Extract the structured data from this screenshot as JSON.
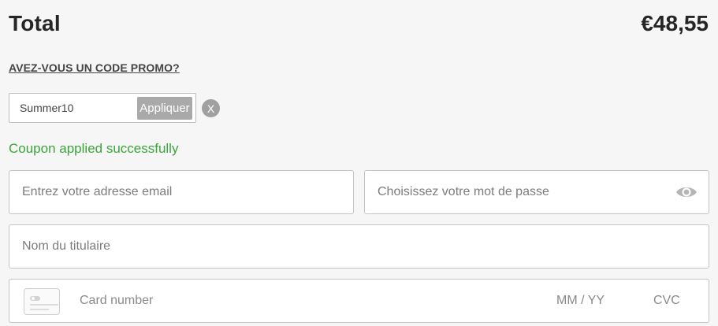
{
  "summary": {
    "total_label": "Total",
    "total_value": "€48,55"
  },
  "promo": {
    "link_text": "AVEZ-VOUS UN CODE PROMO?",
    "code_value": "Summer10",
    "apply_label": "Appliquer",
    "remove_label": "X",
    "success_message": "Coupon applied successfully",
    "success_color": "#3aa63a"
  },
  "form": {
    "email_placeholder": "Entrez votre adresse email",
    "password_placeholder": "Choisissez votre mot de passe",
    "password_toggle_icon": "eye-icon",
    "cardholder_placeholder": "Nom du titulaire",
    "card": {
      "icon": "credit-card-icon",
      "number_placeholder": "Card number",
      "expiry_placeholder": "MM / YY",
      "cvc_placeholder": "CVC"
    }
  },
  "colors": {
    "background": "#f6f6f6",
    "button_gray": "#a9a9a9",
    "field_border": "#c4c4c4"
  }
}
